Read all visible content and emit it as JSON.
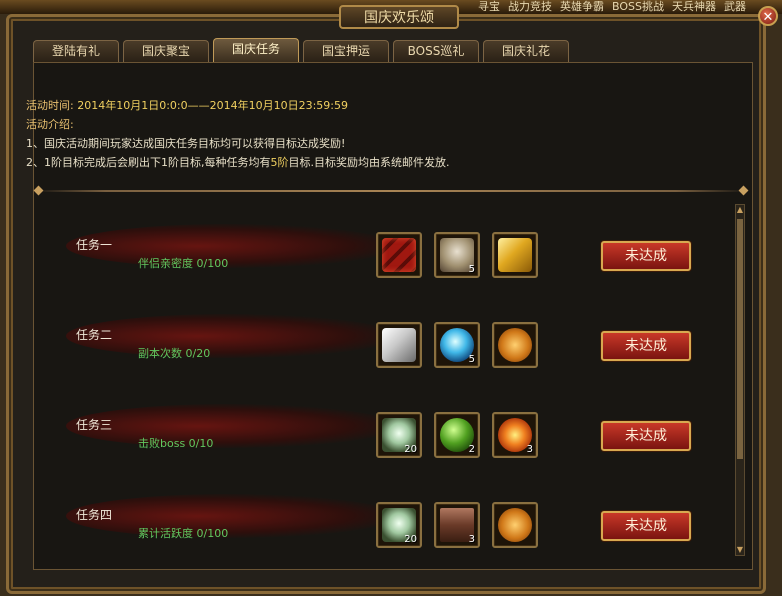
{
  "topmenu": [
    "寻宝",
    "战力竞技",
    "英雄争霸",
    "BOSS挑战",
    "天兵神器",
    "武器"
  ],
  "window": {
    "title": "国庆欢乐颂"
  },
  "tabs": [
    {
      "label": "登陆有礼",
      "active": false
    },
    {
      "label": "国庆聚宝",
      "active": false
    },
    {
      "label": "国庆任务",
      "active": true
    },
    {
      "label": "国宝押运",
      "active": false
    },
    {
      "label": "BOSS巡礼",
      "active": false
    },
    {
      "label": "国庆礼花",
      "active": false
    }
  ],
  "info": {
    "time_label": "活动时间:",
    "time_value": "2014年10月1日0:0:0——2014年10月10日23:59:59",
    "intro_label": "活动介绍:",
    "line1": "1、国庆活动期间玩家达成国庆任务目标均可以获得目标达成奖励!",
    "line2_a": "2、1阶目标完成后会刷出下1阶目标,每种任务均有",
    "line2_hl": "5阶",
    "line2_b": "目标.目标奖励均由系统邮件发放."
  },
  "tasks": [
    {
      "name": "任务一",
      "goal": "伴侣亲密度 0/100",
      "button": "未达成",
      "items": [
        {
          "icon": "red-scroll-icon",
          "count": ""
        },
        {
          "icon": "gem-bag-icon",
          "count": "5"
        },
        {
          "icon": "gold-ingot-icon",
          "count": ""
        }
      ]
    },
    {
      "name": "任务二",
      "goal": "副本次数 0/20",
      "button": "未达成",
      "items": [
        {
          "icon": "silver-ingot-icon",
          "count": ""
        },
        {
          "icon": "blue-orb-icon",
          "count": "5"
        },
        {
          "icon": "bronze-medallion-icon",
          "count": ""
        }
      ]
    },
    {
      "name": "任务三",
      "goal": "击败boss 0/10",
      "button": "未达成",
      "items": [
        {
          "icon": "jade-vase-icon",
          "count": "20"
        },
        {
          "icon": "green-orb-icon",
          "count": "2"
        },
        {
          "icon": "flame-orb-icon",
          "count": "3"
        }
      ]
    },
    {
      "name": "任务四",
      "goal": "累计活跃度 0/100",
      "button": "未达成",
      "items": [
        {
          "icon": "jade-vase-icon",
          "count": "20"
        },
        {
          "icon": "treasure-chest-icon",
          "count": "3"
        },
        {
          "icon": "bronze-medallion-icon",
          "count": ""
        }
      ]
    }
  ],
  "colors": {
    "goal_green": "#60c860",
    "highlight_yellow": "#f0d060",
    "button_red": "#c83828"
  }
}
